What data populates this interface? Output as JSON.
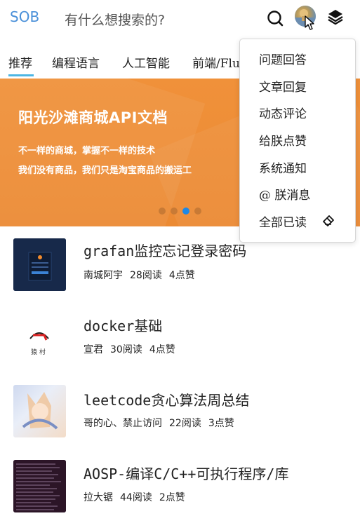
{
  "header": {
    "logo": "SOB",
    "search_placeholder": "有什么想搜索的?"
  },
  "tabs": [
    "推荐",
    "编程语言",
    "人工智能",
    "前端/Flu"
  ],
  "banner": {
    "title": "阳光沙滩商城API文档",
    "line1": "不一样的商城，掌握不一样的技术",
    "line2": "我们没有商品，我们只是淘宝商品的搬运工",
    "slide_count": 4,
    "active_slide": 3
  },
  "dropdown": {
    "items": [
      "问题回答",
      "文章回复",
      "动态评论",
      "给朕点赞",
      "系统通知",
      "@ 朕消息",
      "全部已读"
    ]
  },
  "articles": [
    {
      "title": "grafan监控忘记登录密码",
      "author": "南城阿宇",
      "reads": "28阅读",
      "likes": "4点赞"
    },
    {
      "title": "docker基础",
      "author": "宣君",
      "reads": "30阅读",
      "likes": "4点赞",
      "thumb_text": "猿 村"
    },
    {
      "title": "leetcode贪心算法周总结",
      "author": "哥的心、禁止访问",
      "reads": "22阅读",
      "likes": "3点赞"
    },
    {
      "title": "AOSP-编译C/C++可执行程序/库",
      "author": "拉大锯",
      "reads": "44阅读",
      "likes": "2点赞"
    }
  ],
  "colors": {
    "banner": "#f0913a",
    "logo": "#4a90d9",
    "tab_underline": "#4db6e4",
    "active_dot": "#1e88e5"
  }
}
